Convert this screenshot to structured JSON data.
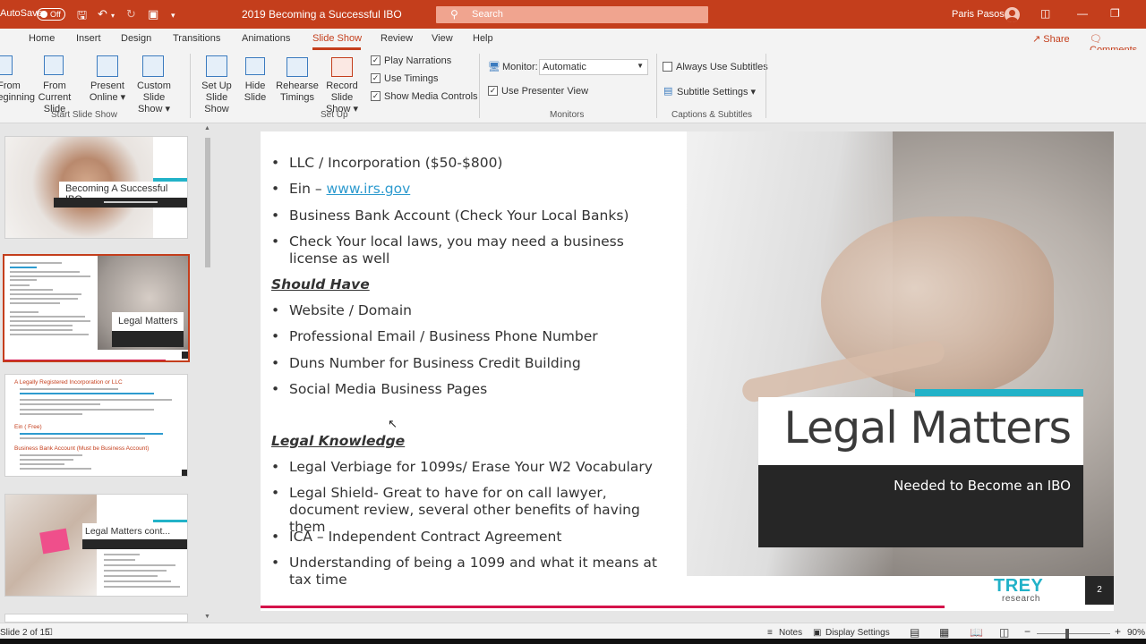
{
  "titlebar": {
    "autosave_label": "AutoSave",
    "autosave_state": "Off",
    "document_title": "2019 Becoming a Successful IBO",
    "search_placeholder": "Search",
    "user_name": "Paris Pasos"
  },
  "menu": {
    "tabs": [
      "Home",
      "Insert",
      "Design",
      "Transitions",
      "Animations",
      "Slide Show",
      "Review",
      "View",
      "Help"
    ],
    "active": "Slide Show",
    "share": "Share",
    "comments": "Comments"
  },
  "ribbon": {
    "start_group": {
      "label": "Start Slide Show",
      "from_beginning": [
        "From",
        "Beginning"
      ],
      "from_current": [
        "From",
        "Current Slide"
      ],
      "present_online": [
        "Present",
        "Online ▾"
      ],
      "custom_show": [
        "Custom Slide",
        "Show ▾"
      ]
    },
    "setup_group": {
      "label": "Set Up",
      "setup_show": [
        "Set Up",
        "Slide Show"
      ],
      "hide_slide": [
        "Hide",
        "Slide"
      ],
      "rehearse": [
        "Rehearse",
        "Timings"
      ],
      "record": [
        "Record Slide",
        "Show ▾"
      ],
      "play_narrations": "Play Narrations",
      "use_timings": "Use Timings",
      "show_media": "Show Media Controls"
    },
    "monitors_group": {
      "label": "Monitors",
      "monitor_label": "Monitor:",
      "monitor_value": "Automatic",
      "presenter_view": "Use Presenter View"
    },
    "captions_group": {
      "label": "Captions & Subtitles",
      "always_subtitles": "Always Use Subtitles",
      "subtitle_settings": "Subtitle Settings ▾"
    }
  },
  "thumbnails": {
    "slide1_title": "Becoming A Successful IBO",
    "slide2_title": "Legal Matters",
    "slide3_heading": "A Legally Registered Incorporation or LLC",
    "slide3_ein": "Ein ( Free)",
    "slide3_bank": "Business Bank Account (Must be Business Account)",
    "slide4_title": "Legal Matters cont..."
  },
  "slide": {
    "bullets_top": [
      "LLC / Incorporation ($50-$800)",
      "Ein – ",
      "Business Bank Account (Check Your Local Banks)",
      "Check Your local laws, you may need a business license as well"
    ],
    "ein_link": "www.irs.gov",
    "should_have_heading": "Should Have",
    "should_have": [
      "Website / Domain",
      "Professional Email / Business Phone Number",
      "Duns Number for Business Credit Building",
      "Social Media Business Pages"
    ],
    "legal_knowledge_heading": "Legal Knowledge",
    "legal_knowledge": [
      "Legal Verbiage for 1099s/ Erase Your W2 Vocabulary",
      "Legal Shield- Great to have for on call lawyer, document review, several other benefits of having them",
      "ICA – Independent Contract Agreement",
      "Understanding of being a 1099 and what it means at tax time"
    ],
    "title": "Legal Matters",
    "subtitle": "Needed to Become an IBO",
    "logo_main": "TREY",
    "logo_sub": "research",
    "page_number": "2"
  },
  "statusbar": {
    "slide_indicator": "Slide 2 of 15",
    "notes": "Notes",
    "display_settings": "Display Settings",
    "zoom": "90%"
  },
  "colors": {
    "accent": "#c43e1c",
    "teal": "#22b2c8",
    "pink_bar": "#d4124a",
    "link": "#2e9bcf"
  }
}
